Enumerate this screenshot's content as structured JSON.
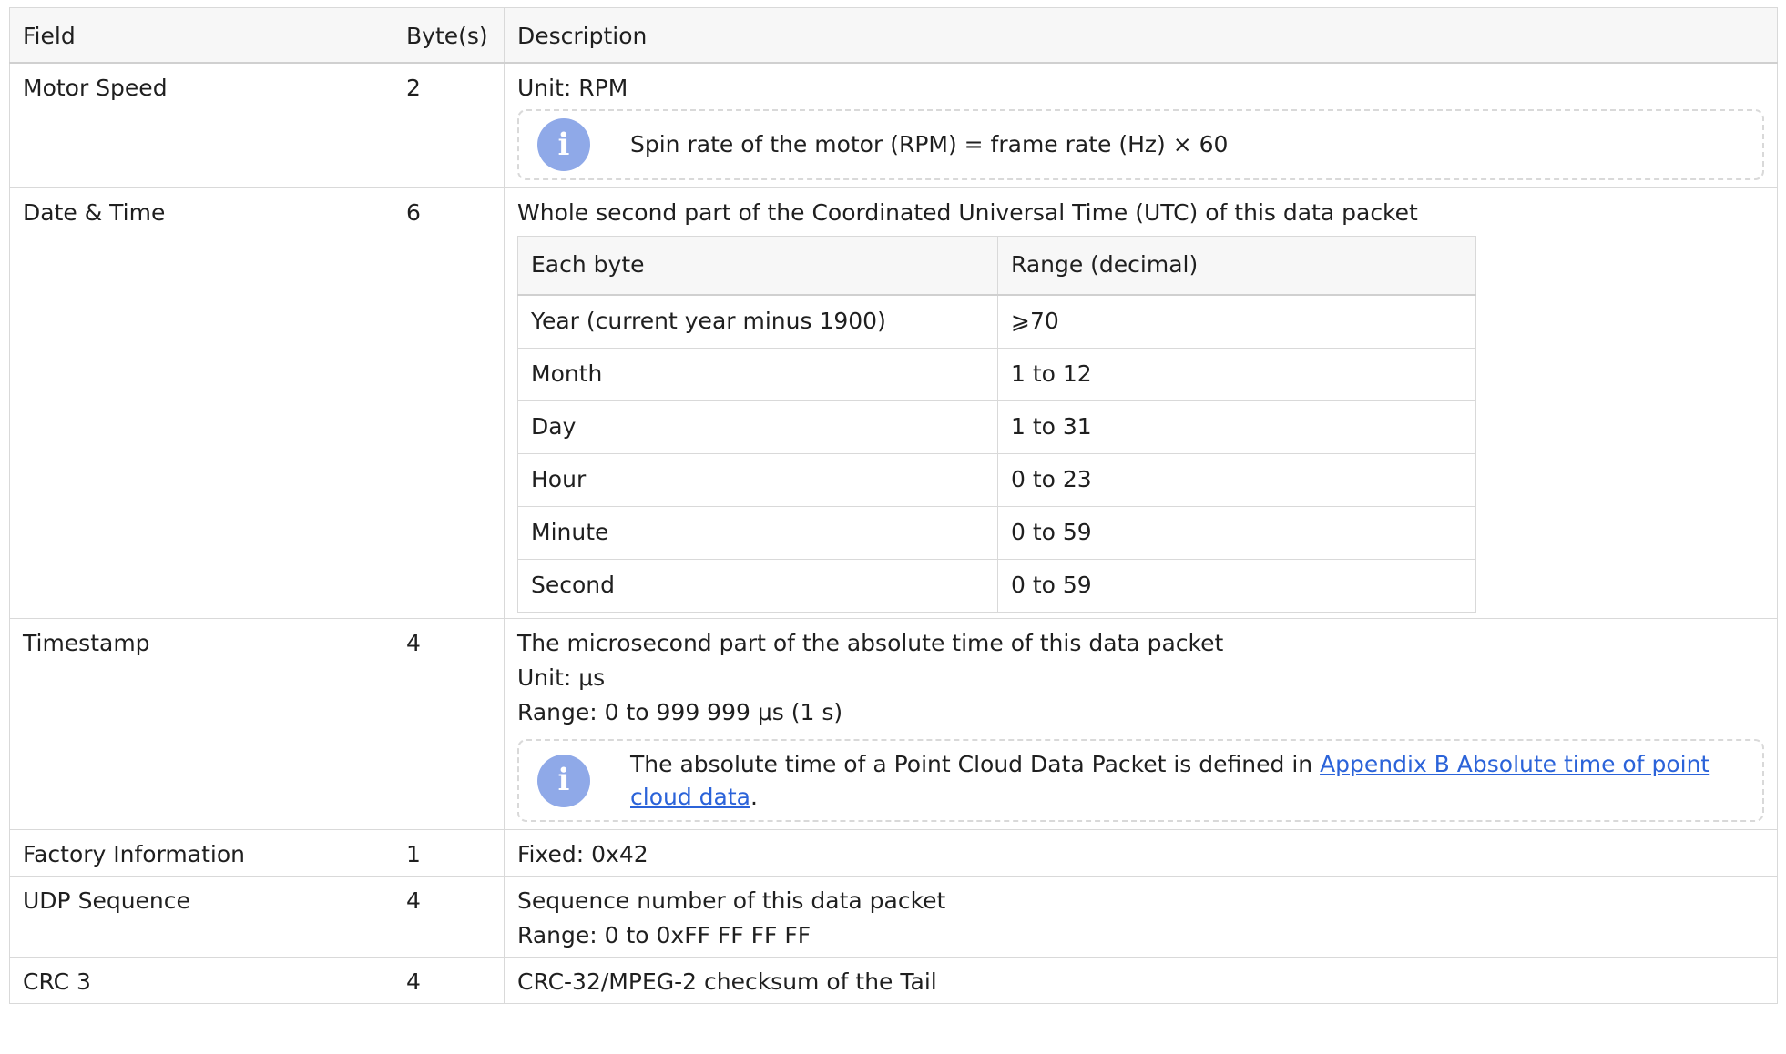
{
  "columns": [
    "Field",
    "Byte(s)",
    "Description"
  ],
  "rows": [
    {
      "field": "Motor Speed",
      "bytes": "2",
      "lines": [
        "Unit: RPM"
      ],
      "note": "Spin rate of the motor (RPM) = frame rate (Hz) × 60"
    },
    {
      "field": "Date & Time",
      "bytes": "6",
      "lines": [
        "Whole second part of the Coordinated Universal Time (UTC) of this data packet"
      ],
      "subtable": {
        "headers": [
          "Each byte",
          "Range (decimal)"
        ],
        "rows": [
          [
            "Year (current year minus 1900)",
            "⩾70"
          ],
          [
            "Month",
            "1 to 12"
          ],
          [
            "Day",
            "1 to 31"
          ],
          [
            "Hour",
            "0 to 23"
          ],
          [
            "Minute",
            "0 to 59"
          ],
          [
            "Second",
            "0 to 59"
          ]
        ]
      }
    },
    {
      "field": "Timestamp",
      "bytes": "4",
      "lines": [
        "The microsecond part of the absolute time of this data packet",
        "Unit: μs",
        "Range: 0 to 999 999 μs (1 s)"
      ],
      "note_parts": {
        "before": "The absolute time of a Point Cloud Data Packet is defined in ",
        "link": "Appendix B Absolute time of point cloud data",
        "after": "."
      }
    },
    {
      "field": "Factory Information",
      "bytes": "1",
      "lines": [
        "Fixed: 0x42"
      ]
    },
    {
      "field": "UDP Sequence",
      "bytes": "4",
      "lines": [
        "Sequence number of this data packet",
        "Range: 0 to 0xFF FF FF FF"
      ]
    },
    {
      "field": "CRC 3",
      "bytes": "4",
      "lines": [
        "CRC-32/MPEG-2 checksum of the Tail"
      ]
    }
  ],
  "note_icon": "info-icon",
  "colors": {
    "border": "#d9d9d9",
    "header_bg": "#f7f7f7",
    "note_icon": "#8fa9e8",
    "link": "#2b63d9"
  }
}
